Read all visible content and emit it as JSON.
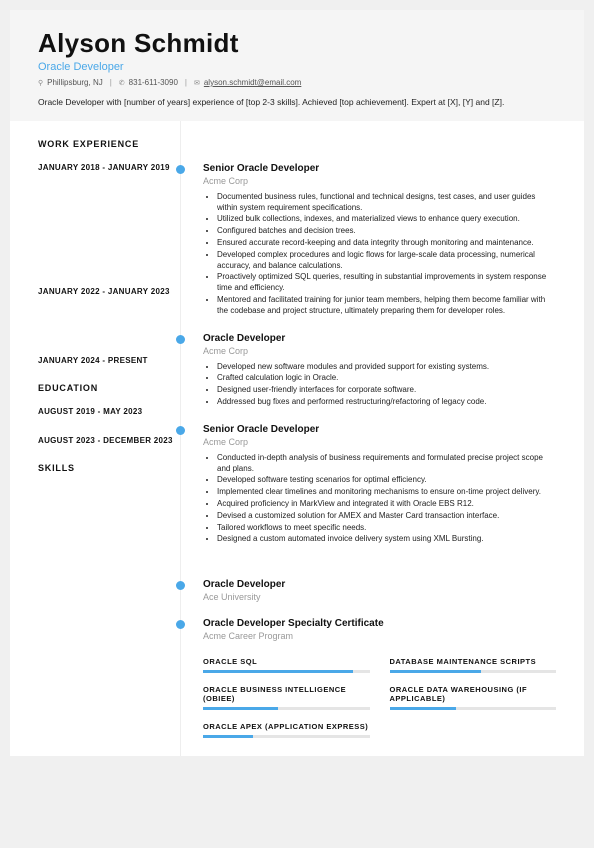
{
  "header": {
    "name": "Alyson Schmidt",
    "title": "Oracle Developer",
    "location": "Phillipsburg, NJ",
    "phone": "831-611-3090",
    "email": "alyson.schmidt@email.com",
    "summary": "Oracle Developer with [number of years] experience of [top 2-3 skills]. Achieved [top achievement]. Expert at [X], [Y] and [Z]."
  },
  "sections": {
    "work": "WORK EXPERIENCE",
    "education": "EDUCATION",
    "skills": "SKILLS"
  },
  "experience": [
    {
      "dates": "JANUARY 2018 - JANUARY 2019",
      "title": "Senior Oracle Developer",
      "company": "Acme Corp",
      "bullets": [
        "Documented business rules, functional and technical designs, test cases, and user guides within system requirement specifications.",
        "Utilized bulk collections, indexes, and materialized views to enhance query execution.",
        "Configured batches and decision trees.",
        "Ensured accurate record-keeping and data integrity through monitoring and maintenance.",
        "Developed complex procedures and logic flows for large-scale data processing, numerical accuracy, and balance calculations.",
        "Proactively optimized SQL queries, resulting in substantial improvements in system response time and efficiency.",
        "Mentored and facilitated training for junior team members, helping them become familiar with the codebase and project structure, ultimately preparing them for developer roles."
      ]
    },
    {
      "dates": "JANUARY 2022 - JANUARY 2023",
      "title": "Oracle Developer",
      "company": "Acme Corp",
      "bullets": [
        "Developed new software modules and provided support for existing systems.",
        "Crafted calculation logic in Oracle.",
        "Designed user-friendly interfaces for corporate software.",
        "Addressed bug fixes and performed restructuring/refactoring of legacy code."
      ]
    },
    {
      "dates": "JANUARY 2024 - PRESENT",
      "title": "Senior Oracle Developer",
      "company": "Acme Corp",
      "bullets": [
        "Conducted in-depth analysis of business requirements and formulated precise project scope and plans.",
        "Developed software testing scenarios for optimal efficiency.",
        "Implemented clear timelines and monitoring mechanisms to ensure on-time project delivery.",
        "Acquired proficiency in MarkView and integrated it with Oracle EBS R12.",
        "Devised a customized solution for AMEX and Master Card transaction interface.",
        "Tailored workflows to meet specific needs.",
        "Designed a custom automated invoice delivery system using XML Bursting."
      ]
    }
  ],
  "education": [
    {
      "dates": "AUGUST 2019 - MAY 2023",
      "title": "Oracle Developer",
      "school": "Ace University"
    },
    {
      "dates": "AUGUST 2023 - DECEMBER 2023",
      "title": "Oracle Developer Specialty Certificate",
      "school": "Acme Career Program"
    }
  ],
  "skills": [
    {
      "name": "ORACLE SQL",
      "level": 90
    },
    {
      "name": "DATABASE MAINTENANCE SCRIPTS",
      "level": 55
    },
    {
      "name": "ORACLE BUSINESS INTELLIGENCE (OBIEE)",
      "level": 45
    },
    {
      "name": "ORACLE DATA WAREHOUSING (IF APPLICABLE)",
      "level": 40
    },
    {
      "name": "ORACLE APEX (APPLICATION EXPRESS)",
      "level": 30
    }
  ]
}
